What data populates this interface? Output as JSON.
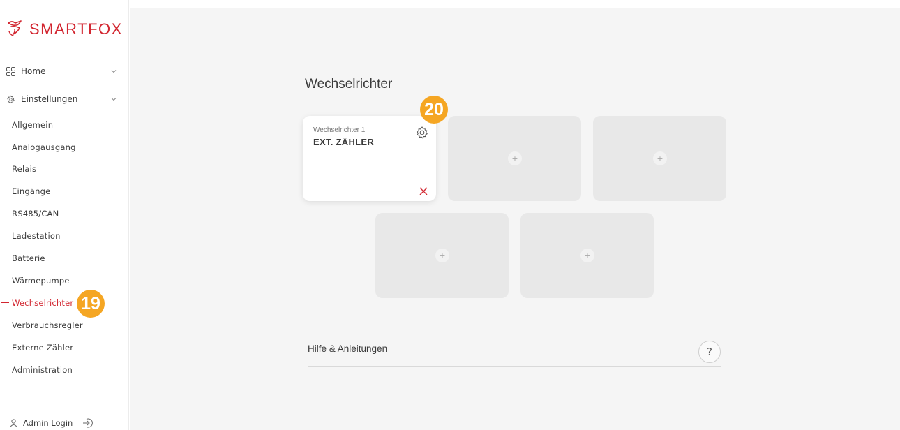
{
  "brand": {
    "name": "SMARTFOX",
    "color": "#d22630",
    "icon": "fox-logo-icon"
  },
  "sidebar": {
    "home": {
      "label": "Home",
      "icon": "grid-icon"
    },
    "settings": {
      "label": "Einstellungen",
      "icon": "gear-icon"
    },
    "items": [
      {
        "label": "Allgemein"
      },
      {
        "label": "Analogausgang"
      },
      {
        "label": "Relais"
      },
      {
        "label": "Eingänge"
      },
      {
        "label": "RS485/CAN"
      },
      {
        "label": "Ladestation"
      },
      {
        "label": "Batterie"
      },
      {
        "label": "Wärmepumpe"
      },
      {
        "label": "Wechselrichter",
        "active": true
      },
      {
        "label": "Verbrauchsregler"
      },
      {
        "label": "Externe Zähler"
      },
      {
        "label": "Administration"
      }
    ],
    "admin_label": "Admin Login"
  },
  "badges": {
    "sidebar": "19",
    "card": "20",
    "color": "#f5a623"
  },
  "main": {
    "title": "Wechselrichter",
    "card": {
      "subtitle": "Wechselrichter 1",
      "name": "EXT. ZÄHLER"
    },
    "add_symbol": "+",
    "help": {
      "label": "Hilfe & Anleitungen",
      "symbol": "?"
    }
  }
}
